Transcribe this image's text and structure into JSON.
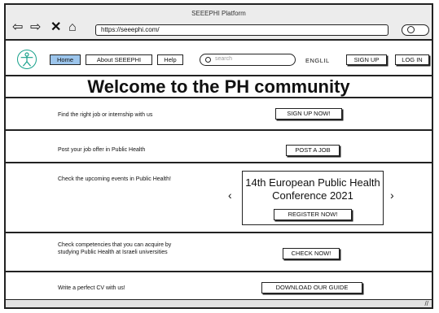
{
  "window": {
    "title": "SEEEPHI Platform"
  },
  "browser": {
    "url": "https://seeephi.com/"
  },
  "nav": {
    "items": [
      "Home",
      "About SEEEPHI",
      "Help"
    ],
    "search_placeholder": "search",
    "language": "ENGLIL",
    "signup_label": "SIGN UP",
    "login_label": "LOG IN"
  },
  "hero": {
    "title": "Welcome to the PH community"
  },
  "rows": [
    {
      "text": "Find the right job or internship with us",
      "button": "SIGN UP NOW!"
    },
    {
      "text": "Post your job offer in Public Health",
      "button": "POST A JOB"
    },
    {
      "text": "Check the upcoming events in Public Health!",
      "event_title": "14th European Public Health Conference 2021",
      "button": "REGISTER NOW!"
    },
    {
      "text": "Check competencies that you can acquire by studying Public Health at Israeli universities",
      "button": "CHECK NOW!"
    },
    {
      "text": "Write a perfect CV with us!",
      "button": "DOWNLOAD OUR GUIDE"
    }
  ],
  "icons": {
    "back": "back-arrow-icon",
    "forward": "forward-arrow-icon",
    "close": "close-icon",
    "home": "home-icon",
    "search": "search-icon",
    "logo": "vitruvian-man-logo",
    "prev": "chevron-left-icon",
    "next": "chevron-right-icon",
    "grip": "resize-grip-icon"
  },
  "colors": {
    "active_nav": "#9cc5ec",
    "logo": "#16a08a"
  }
}
